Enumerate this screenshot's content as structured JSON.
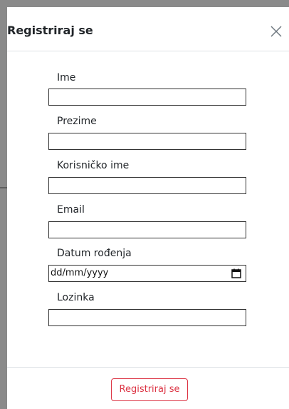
{
  "modal": {
    "title": "Registriraj se",
    "close_icon": "close-icon"
  },
  "form": {
    "fields": [
      {
        "label": "Ime",
        "type": "text",
        "value": ""
      },
      {
        "label": "Prezime",
        "type": "text",
        "value": ""
      },
      {
        "label": "Korisničko ime",
        "type": "text",
        "value": ""
      },
      {
        "label": "Email",
        "type": "email",
        "value": ""
      },
      {
        "label": "Datum rođenja",
        "type": "date",
        "placeholder": "dd/mm/yyyy",
        "icon": "calendar-icon"
      },
      {
        "label": "Lozinka",
        "type": "password",
        "value": ""
      }
    ]
  },
  "footer": {
    "submit_label": "Registriraj se"
  },
  "colors": {
    "accent": "#dc3545",
    "backdrop": "#8a8a8a",
    "divider": "#dee2e6",
    "text": "#212529"
  }
}
